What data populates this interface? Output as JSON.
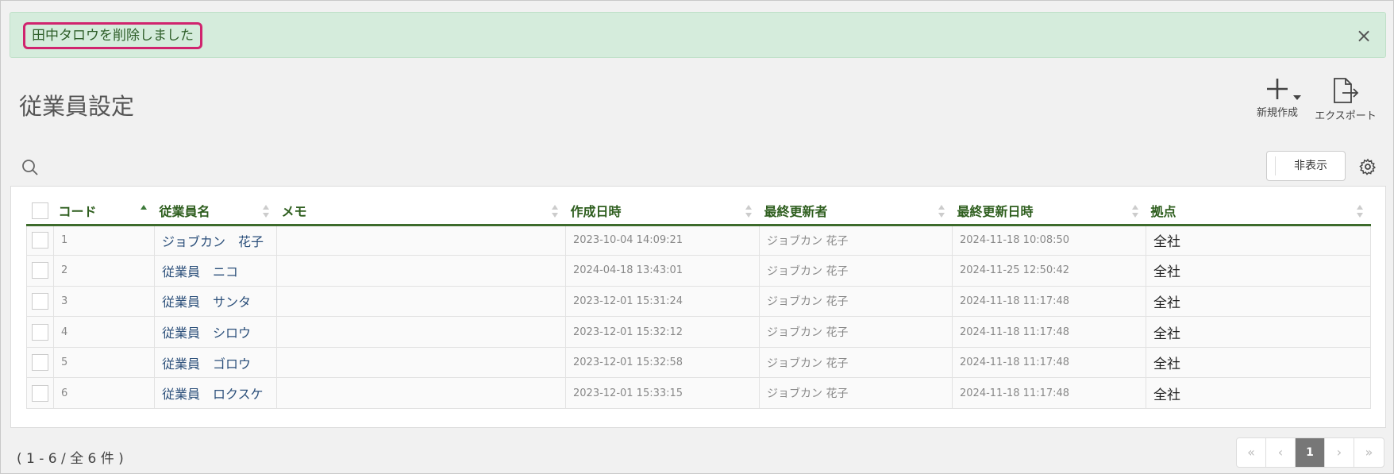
{
  "alert": {
    "message": "田中タロウを削除しました",
    "close": "×"
  },
  "page": {
    "title": "従業員設定"
  },
  "actions": {
    "new_label": "新規作成",
    "export_label": "エクスポート"
  },
  "toolbar": {
    "hide_label": "非表示"
  },
  "table": {
    "headers": [
      "コード",
      "従業員名",
      "メモ",
      "作成日時",
      "最終更新者",
      "最終更新日時",
      "拠点"
    ],
    "rows": [
      {
        "code": "1",
        "name": "ジョブカン　花子",
        "memo": "",
        "created": "2023-10-04 14:09:21",
        "updater": "ジョブカン 花子",
        "updated": "2024-11-18 10:08:50",
        "base": "全社"
      },
      {
        "code": "2",
        "name": "従業員　ニコ",
        "memo": "",
        "created": "2024-04-18 13:43:01",
        "updater": "ジョブカン 花子",
        "updated": "2024-11-25 12:50:42",
        "base": "全社"
      },
      {
        "code": "3",
        "name": "従業員　サンタ",
        "memo": "",
        "created": "2023-12-01 15:31:24",
        "updater": "ジョブカン 花子",
        "updated": "2024-11-18 11:17:48",
        "base": "全社"
      },
      {
        "code": "4",
        "name": "従業員　シロウ",
        "memo": "",
        "created": "2023-12-01 15:32:12",
        "updater": "ジョブカン 花子",
        "updated": "2024-11-18 11:17:48",
        "base": "全社"
      },
      {
        "code": "5",
        "name": "従業員　ゴロウ",
        "memo": "",
        "created": "2023-12-01 15:32:58",
        "updater": "ジョブカン 花子",
        "updated": "2024-11-18 11:17:48",
        "base": "全社"
      },
      {
        "code": "6",
        "name": "従業員　ロクスケ",
        "memo": "",
        "created": "2023-12-01 15:33:15",
        "updater": "ジョブカン 花子",
        "updated": "2024-11-18 11:17:48",
        "base": "全社"
      }
    ]
  },
  "footer": {
    "count": "( 1 - 6 / 全 6 件 )",
    "pager": {
      "first": "«",
      "prev": "‹",
      "current": "1",
      "next": "›",
      "last": "»"
    }
  }
}
